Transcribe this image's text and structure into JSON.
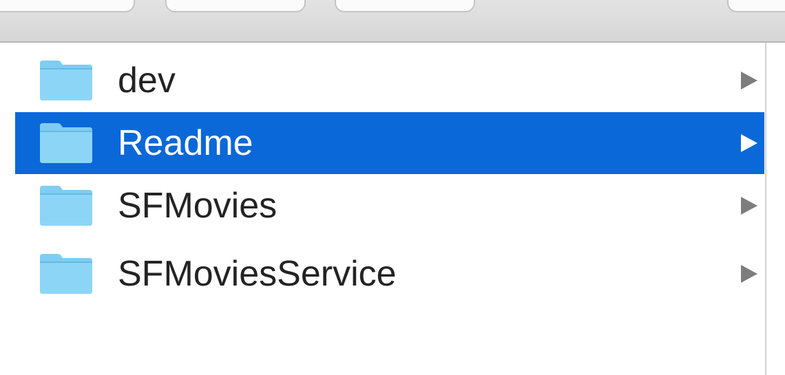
{
  "items": [
    {
      "name": "dev",
      "icon": "folder-icon",
      "selected": false
    },
    {
      "name": "Readme",
      "icon": "folder-icon",
      "selected": true
    },
    {
      "name": "SFMovies",
      "icon": "folder-icon",
      "selected": false
    },
    {
      "name": "SFMoviesService",
      "icon": "folder-icon",
      "selected": false
    }
  ],
  "colors": {
    "selection": "#0b68d8",
    "folder": "#7fcdf3",
    "text": "#232323",
    "disclosure_arrow": "#7d7d7d"
  }
}
